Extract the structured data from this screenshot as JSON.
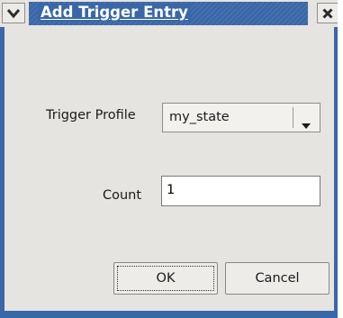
{
  "window": {
    "title": "Add Trigger Entry"
  },
  "titlebar": {
    "menu_icon": "chevron-down-icon",
    "close_icon": "close-icon"
  },
  "form": {
    "trigger_profile_label": "Trigger Profile",
    "trigger_profile_value": "my_state",
    "count_label": "Count",
    "count_value": "1"
  },
  "buttons": {
    "ok_label": "OK",
    "cancel_label": "Cancel"
  },
  "colors": {
    "title_bar_active": "#3a67a8",
    "dialog_background": "#e6e4e0"
  }
}
